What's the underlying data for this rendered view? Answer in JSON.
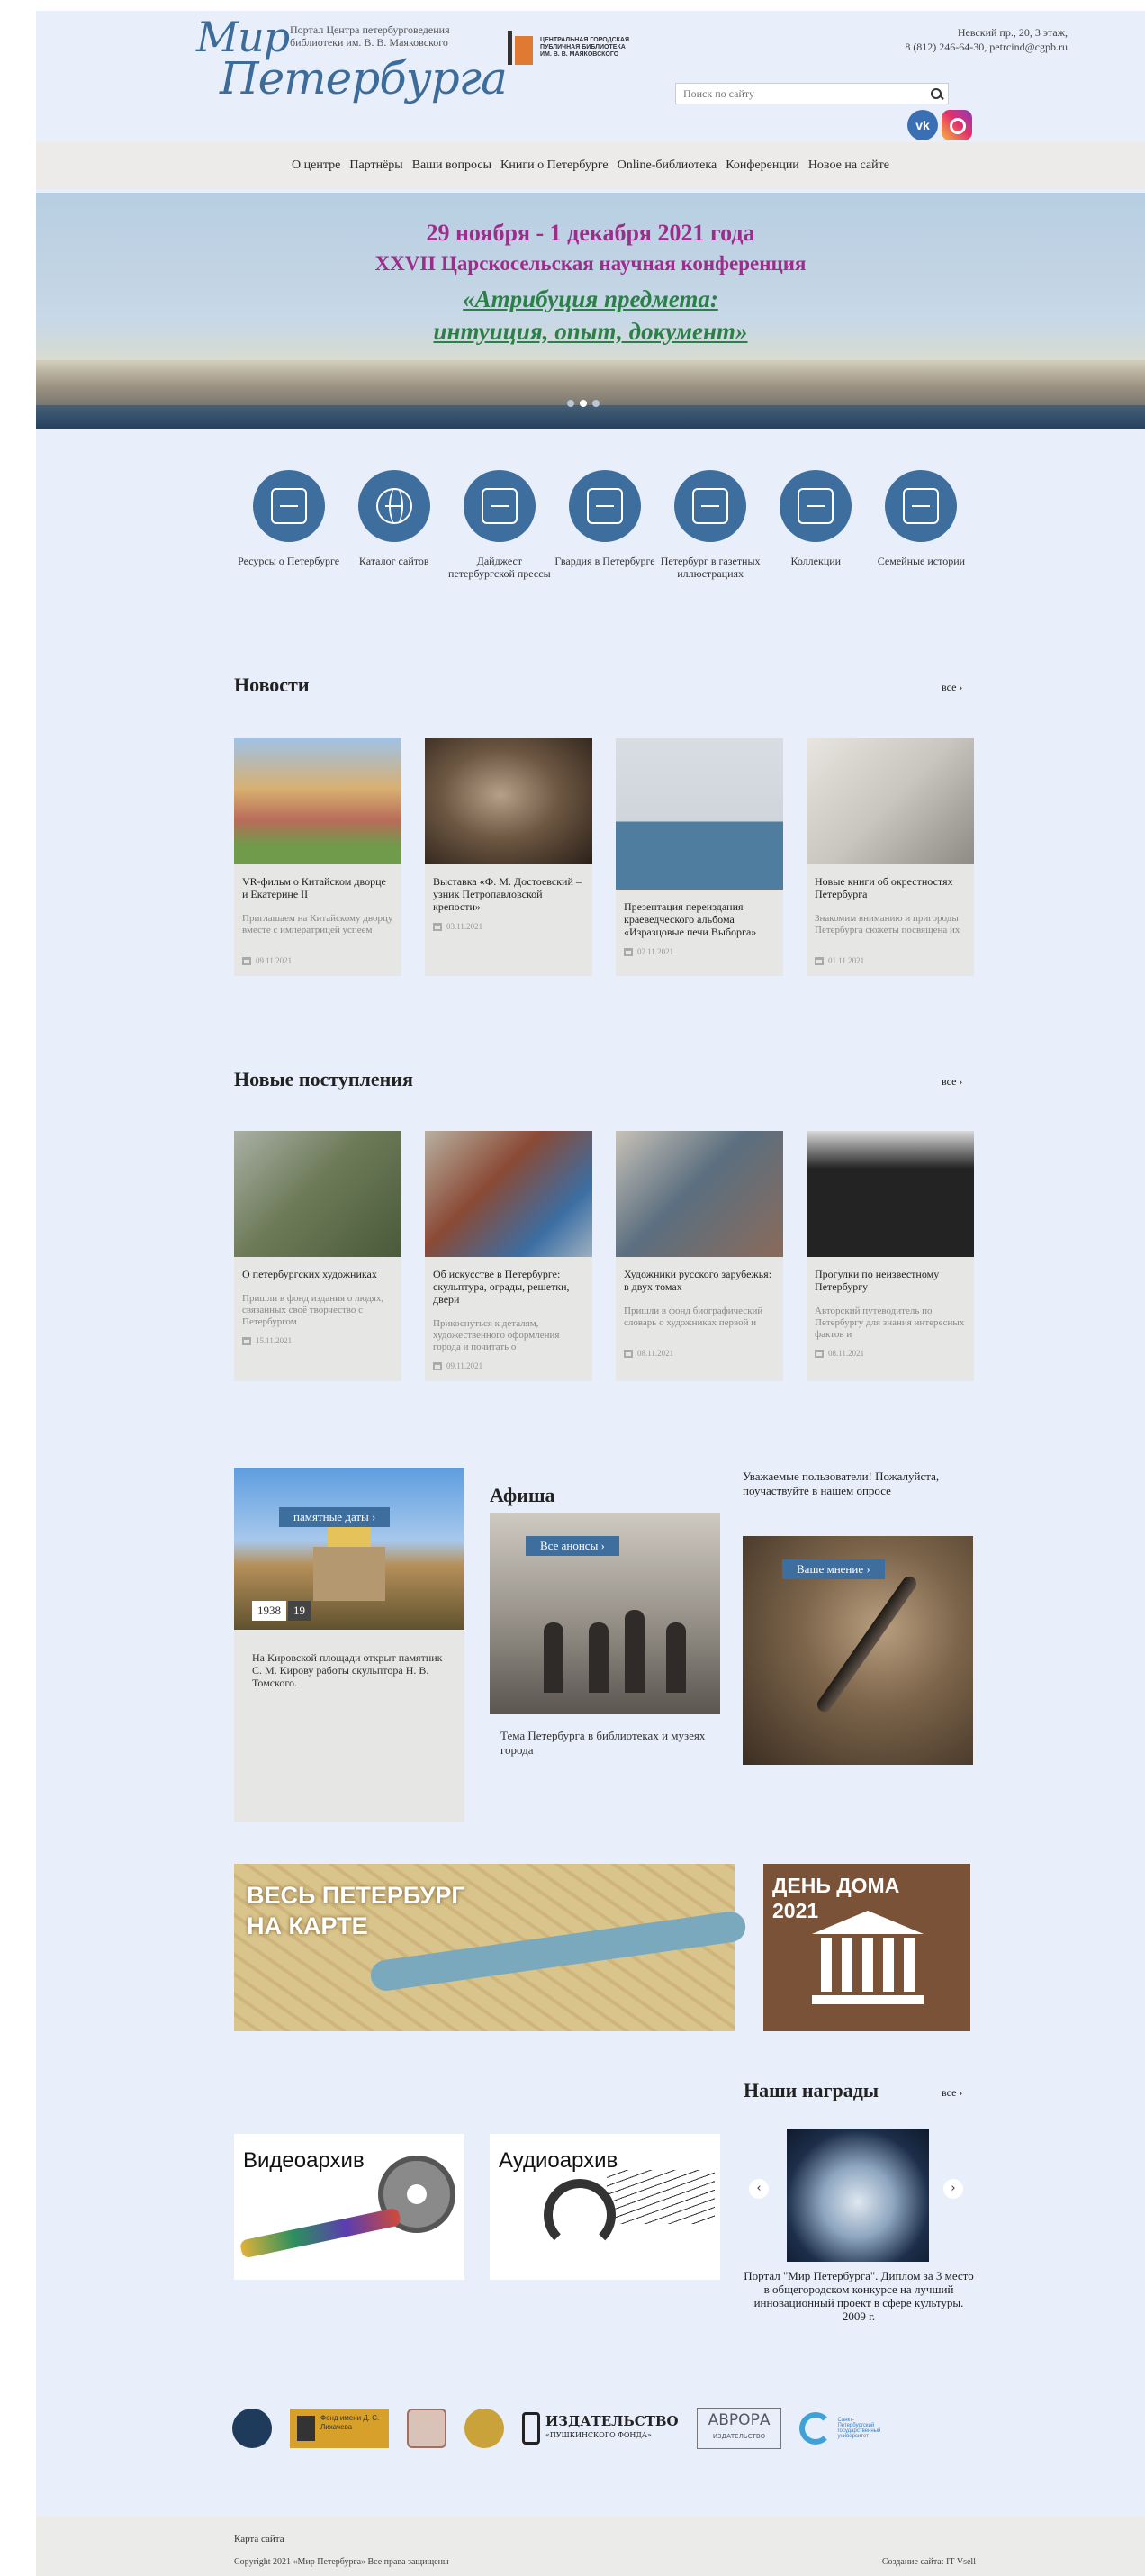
{
  "header": {
    "logo_line1": "Мир",
    "logo_line2": "Петербурга",
    "portal_caption": "Портал Центра петербурговедения библиотеки им. В. В. Маяковского",
    "library_logo_text": "ЦЕНТРАЛЬНАЯ ГОРОДСКАЯ ПУБЛИЧНАЯ БИБЛИОТЕКА ИМ. В. В. МАЯКОВСКОГО",
    "address": "Невский пр., 20, 3 этаж,",
    "phone_email": "8 (812) 246-64-30, petrcind@cgpb.ru",
    "search_placeholder": "Поиск по сайту",
    "vk_label": "vk"
  },
  "nav": {
    "items": [
      "О центре",
      "Партнёры",
      "Ваши вопросы",
      "Книги о Петербурге",
      "Online-библиотека",
      "Конференции",
      "Новое на сайте"
    ]
  },
  "banner": {
    "line1": "29 ноября - 1 декабря 2021 года",
    "line2": "XXVII Царскосельская научная конференция",
    "line3": "«Атрибуция предмета:",
    "line4": "интуиция, опыт, документ»",
    "slides": 3,
    "active_slide": 1
  },
  "quick_links": [
    {
      "label": "Ресурсы о Петербурге",
      "icon": "hand-book-icon"
    },
    {
      "label": "Каталог сайтов",
      "icon": "globe-icon"
    },
    {
      "label": "Дайджест петербургской прессы",
      "icon": "newspaper-icon"
    },
    {
      "label": "Гвардия в Петербурге",
      "icon": "guard-icon"
    },
    {
      "label": "Петербург в газетных иллюстрациях",
      "icon": "pen-paper-icon"
    },
    {
      "label": "Коллекции",
      "icon": "collection-icon"
    },
    {
      "label": "Семейные истории",
      "icon": "family-house-icon"
    }
  ],
  "news": {
    "title": "Новости",
    "all_label": "все ›",
    "items": [
      {
        "title": "VR-фильм о Китайском дворце и Екатерине II",
        "snippet": "Приглашаем на Китайскому дворцу вместе с императрицей успеем",
        "date": "09.11.2021",
        "color": "#8aa05a"
      },
      {
        "title": "Выставка «Ф. М. Достоевский – узник Петропавловской крепости»",
        "snippet": "",
        "date": "03.11.2021",
        "color": "#4b3a2a"
      },
      {
        "title": "Презентация переиздания краеведческого альбома «Изразцовые печи Выборга»",
        "snippet": "",
        "date": "02.11.2021",
        "color": "#4f7da0"
      },
      {
        "title": "Новые книги об окрестностях Петербурга",
        "snippet": "Знакомим вниманию и пригороды Петербурга сюжеты посвящена их",
        "date": "01.11.2021",
        "color": "#c9c5bf"
      }
    ]
  },
  "arrivals": {
    "title": "Новые поступления",
    "all_label": "все ›",
    "items": [
      {
        "title": "О петербургских художниках",
        "snippet": "Пришли в фонд издания о людях, связанных своё творчество с Петербургом",
        "date": "15.11.2021",
        "color": "#6d7b58"
      },
      {
        "title": "Об искусстве в Петербурге: скульптура, ограды, решетки, двери",
        "snippet": "Прикоснуться к деталям, художественного оформления города и почитать о",
        "date": "09.11.2021",
        "color": "#8a4a35"
      },
      {
        "title": "Художники русского зарубежья: в двух томах",
        "snippet": "Пришли в фонд биографический словарь о художниках первой и",
        "date": "08.11.2021",
        "color": "#5b6f80"
      },
      {
        "title": "Прогулки по неизвестному Петербургу",
        "snippet": "Авторский путеводитель по Петербургу для знания интересных фактов и",
        "date": "08.11.2021",
        "color": "#232323"
      }
    ]
  },
  "dates_block": {
    "pill": "памятные даты ›",
    "year_a": "1938",
    "year_b": "19",
    "text": "На Кировской площади открыт памятник С. М. Кирову работы скульптора Н. В. Томского."
  },
  "afisha": {
    "title": "Афиша",
    "pill": "Все анонсы ›",
    "text": "Тема Петербурга в библиотеках и музеях города"
  },
  "opinion": {
    "text": "Уважаемые пользователи! Пожалуйста, поучаствуйте в нашем опросе",
    "pill": "Ваше мнение ›"
  },
  "map_banner": {
    "line1": "ВЕСЬ ПЕТЕРБУРГ",
    "line2": "НА КАРТЕ"
  },
  "house_banner": {
    "line1": "ДЕНЬ ДОМА",
    "line2": "2021"
  },
  "awards": {
    "title": "Наши награды",
    "all_label": "все ›",
    "text": "Портал \"Мир Петербурга\". Диплом за 3 место в общегородском конкурсе на лучший инновационный проект в сфере культуры. 2009 г."
  },
  "archives": {
    "video": "Видеоархив",
    "audio": "Аудиоархив"
  },
  "partners": {
    "fund_label": "Фонд имени Д. С. Лихачева",
    "izd_main": "ИЗДАТЕЛЬСТВО",
    "izd_sub": "«ПУШКИНСКОГО ФОНДА»",
    "avrora": "АВРОРА",
    "avrora_sub": "ИЗДАТЕЛЬСТВО",
    "blue_label": "Санкт-Петербургский государственный университет"
  },
  "footer": {
    "sitemap": "Карта сайта",
    "copyright": "Copyright 2021 «Мир Петербурга» Все права защищены",
    "credit": "Создание сайта: IT-Vsell"
  },
  "colors": {
    "accent": "#3e6e9e",
    "page_bg": "#e8eefa",
    "banner_text": "#9a2f8a",
    "banner_accent": "#2d7f49"
  }
}
